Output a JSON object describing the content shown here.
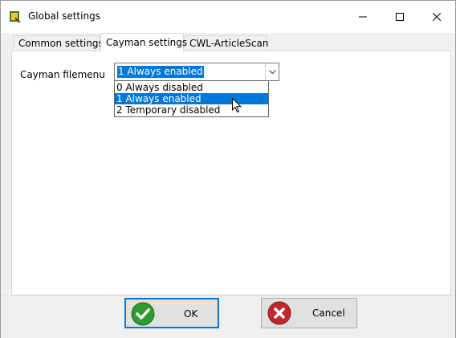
{
  "window": {
    "title": "Global settings",
    "icon": "app-settings-icon"
  },
  "tabs": [
    {
      "label": "Common settings",
      "active": false
    },
    {
      "label": "Cayman settings",
      "active": true
    },
    {
      "label": "CWL-ArticleScan",
      "active": false
    }
  ],
  "cayman": {
    "field_label": "Cayman filemenu",
    "selected_value": "1 Always enabled",
    "options": [
      "0 Always disabled",
      "1 Always enabled",
      "2 Temporary disabled"
    ],
    "highlighted_index": 1
  },
  "buttons": {
    "ok_label": "OK",
    "cancel_label": "Cancel"
  },
  "colors": {
    "accent": "#0078d7",
    "ok_green": "#2e9c2e",
    "cancel_red": "#c0272d"
  }
}
